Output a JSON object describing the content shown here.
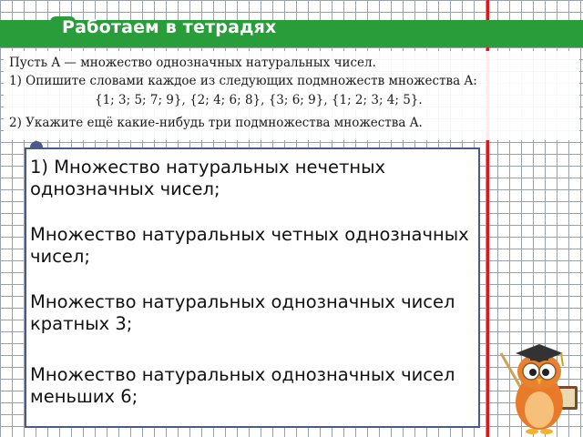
{
  "header": {
    "title": "Работаем в тетрадях"
  },
  "task": {
    "line1": "Пусть  A — множество однозначных натуральных чисел.",
    "line2": "1)  Опишите словами каждое из следующих подмножеств множества A:",
    "line3": "{1; 3; 5; 7; 9},    {2; 4; 6; 8},    {3; 6; 9},    {1; 2; 3; 4; 5}.",
    "line4": "2)  Укажите ещё какие-нибудь три подмножества множества A."
  },
  "answers": [
    "1) Множество натуральных нечетных однозначных чисел;",
    "Множество натуральных четных однозначных чисел;",
    "Множество натуральных однозначных чисел кратных 3;",
    "Множество натуральных однозначных чисел меньших 6;"
  ],
  "colors": {
    "header_green": "#2a9d3b",
    "margin_red": "#e0161c",
    "box_border": "#4a5a8a"
  },
  "icons": {
    "mascot": "owl-teacher-icon"
  }
}
